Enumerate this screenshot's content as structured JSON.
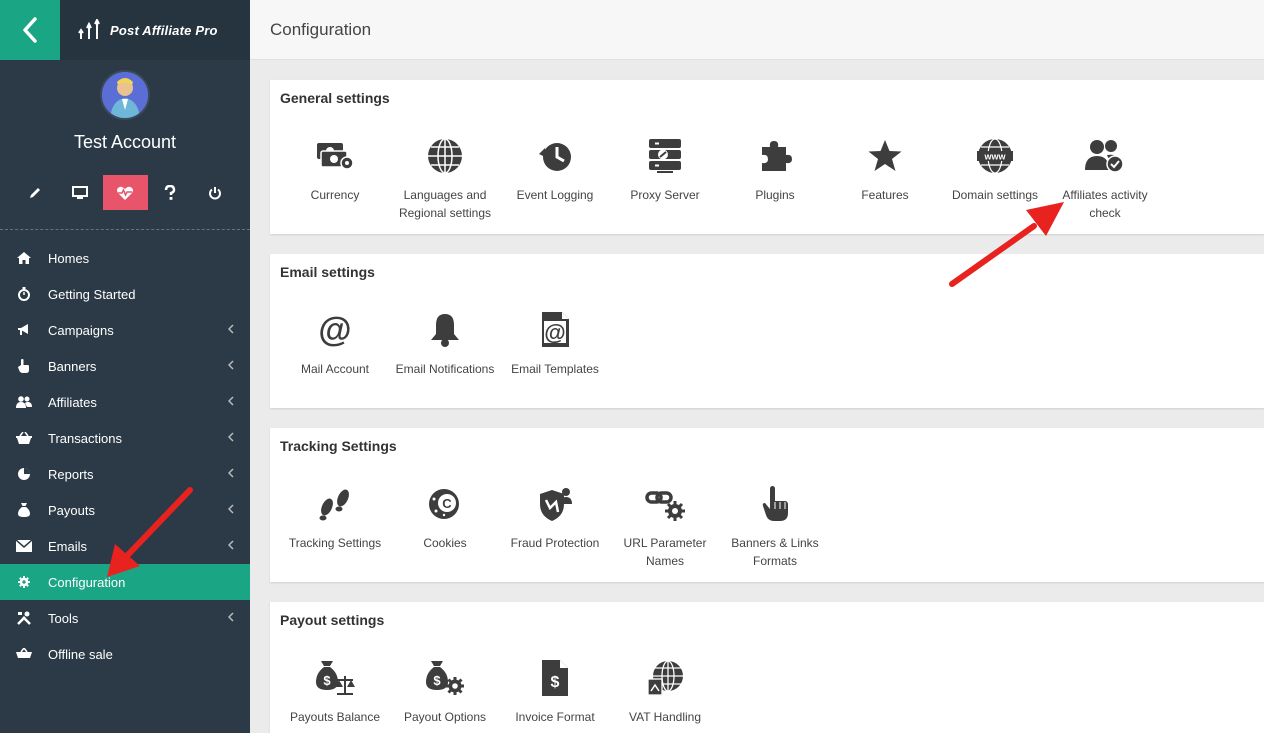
{
  "brand": {
    "name": "Post Affiliate Pro"
  },
  "profile": {
    "name": "Test Account"
  },
  "header": {
    "title": "Configuration"
  },
  "sidebar": {
    "items": [
      {
        "label": "Homes",
        "icon": "home-icon",
        "chevron": false
      },
      {
        "label": "Getting Started",
        "icon": "stopwatch-icon",
        "chevron": false
      },
      {
        "label": "Campaigns",
        "icon": "megaphone-icon",
        "chevron": true
      },
      {
        "label": "Banners",
        "icon": "hand-icon",
        "chevron": true
      },
      {
        "label": "Affiliates",
        "icon": "users-icon",
        "chevron": true
      },
      {
        "label": "Transactions",
        "icon": "basket-icon",
        "chevron": true
      },
      {
        "label": "Reports",
        "icon": "pie-chart-icon",
        "chevron": true
      },
      {
        "label": "Payouts",
        "icon": "money-bag-icon",
        "chevron": true
      },
      {
        "label": "Emails",
        "icon": "envelope-icon",
        "chevron": true
      },
      {
        "label": "Configuration",
        "icon": "gear-icon",
        "chevron": false,
        "active": true
      },
      {
        "label": "Tools",
        "icon": "tools-icon",
        "chevron": true
      },
      {
        "label": "Offline sale",
        "icon": "cart-icon",
        "chevron": false
      }
    ]
  },
  "sections": {
    "general": {
      "title": "General settings",
      "items": [
        "Currency",
        "Languages and Regional settings",
        "Event Logging",
        "Proxy Server",
        "Plugins",
        "Features",
        "Domain settings",
        "Affiliates activity check"
      ]
    },
    "email": {
      "title": "Email settings",
      "items": [
        "Mail Account",
        "Email Notifications",
        "Email Templates"
      ]
    },
    "tracking": {
      "title": "Tracking Settings",
      "items": [
        "Tracking Settings",
        "Cookies",
        "Fraud Protection",
        "URL Parameter Names",
        "Banners & Links Formats"
      ]
    },
    "payout": {
      "title": "Payout settings",
      "items": [
        "Payouts Balance",
        "Payout Options",
        "Invoice Format",
        "VAT Handling"
      ]
    }
  },
  "colors": {
    "accent": "#1aa585",
    "sidebar": "#2b3a46",
    "active_tool": "#e8546a",
    "arrow": "#e8231f"
  }
}
